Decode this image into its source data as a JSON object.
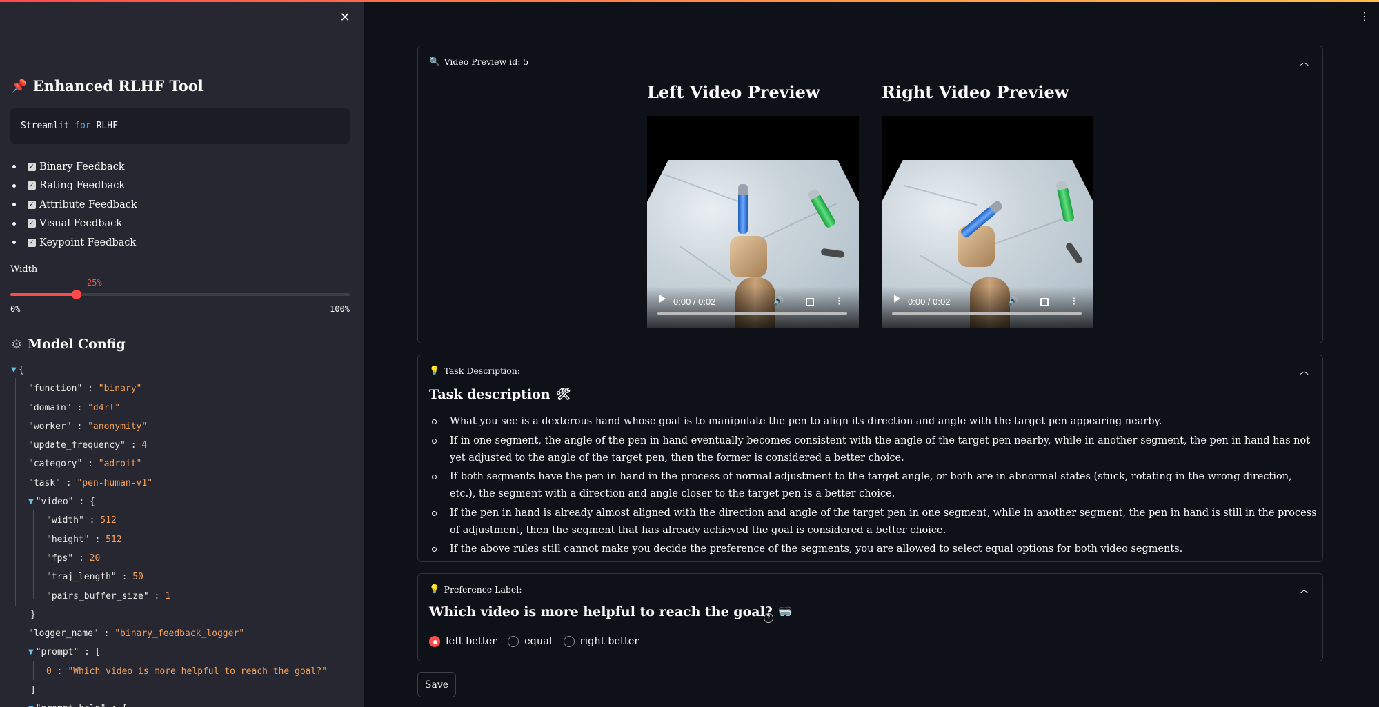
{
  "sidebar": {
    "close_icon": "close-icon",
    "title": "Enhanced RLHF Tool",
    "title_icon": "pushpin-icon",
    "code": {
      "word1": "Streamlit",
      "keyword": "for",
      "word2": "RLHF"
    },
    "features": [
      {
        "label": "Binary Feedback",
        "checked": true
      },
      {
        "label": "Rating Feedback",
        "checked": true
      },
      {
        "label": "Attribute Feedback",
        "checked": true
      },
      {
        "label": "Visual Feedback",
        "checked": true
      },
      {
        "label": "Keypoint Feedback",
        "checked": true
      }
    ],
    "width_slider": {
      "label": "Width",
      "value": 0.25,
      "value_text": "25%",
      "min": "0%",
      "max": "100%"
    },
    "model_config_title": "Model Config",
    "model_config_icon": "gear-icon",
    "json": {
      "function": "\"binary\"",
      "domain": "\"d4rl\"",
      "worker": "\"anonymity\"",
      "update_frequency": "4",
      "category": "\"adroit\"",
      "task": "\"pen-human-v1\"",
      "video_width": "512",
      "video_height": "512",
      "video_fps": "20",
      "video_traj_length": "50",
      "video_pairs_buffer_size": "1",
      "logger_name": "\"binary_feedback_logger\"",
      "prompt_0": "\"Which video is more helpful to reach the goal?\"",
      "keys": {
        "function": "\"function\"",
        "domain": "\"domain\"",
        "worker": "\"worker\"",
        "update_frequency": "\"update_frequency\"",
        "category": "\"category\"",
        "task": "\"task\"",
        "video": "\"video\"",
        "width": "\"width\"",
        "height": "\"height\"",
        "fps": "\"fps\"",
        "traj_length": "\"traj_length\"",
        "pairs_buffer_size": "\"pairs_buffer_size\"",
        "logger_name": "\"logger_name\"",
        "prompt": "\"prompt\"",
        "prompt_help": "\"prompt_help\""
      }
    }
  },
  "main": {
    "video_panel": {
      "header": "Video Preview id: 5",
      "header_icon": "magnifier-icon",
      "left_title": "Left Video Preview",
      "right_title": "Right Video Preview",
      "left_time": "0:00 / 0:02",
      "right_time": "0:00 / 0:02"
    },
    "task_panel": {
      "header": "Task Description:",
      "header_icon": "lightbulb-icon",
      "title": "Task description",
      "title_icon": "tools-icon",
      "items": [
        "What you see is a dexterous hand whose goal is to manipulate the pen to align its direction and angle with the target pen appearing nearby.",
        "If in one segment, the angle of the pen in hand eventually becomes consistent with the angle of the target pen nearby, while in another segment, the pen in hand has not yet adjusted to the angle of the target pen, then the former is considered a better choice.",
        "If both segments have the pen in hand in the process of normal adjustment to the target angle, or both are in abnormal states (stuck, rotating in the wrong direction, etc.), the segment with a direction and angle closer to the target pen is a better choice.",
        "If the pen in hand is already almost aligned with the direction and angle of the target pen in one segment, while in another segment, the pen in hand is still in the process of adjustment, then the segment that has already achieved the goal is considered a better choice.",
        "If the above rules still cannot make you decide the preference of the segments, you are allowed to select equal options for both video segments."
      ]
    },
    "pref_panel": {
      "header": "Preference Label:",
      "header_icon": "lightbulb-icon",
      "question": "Which video is more helpful to reach the goal?",
      "question_icon": "vr-goggles-icon",
      "help_icon": "question-circle-icon",
      "options": [
        "left better",
        "equal",
        "right better"
      ],
      "selected": "left better"
    },
    "save_label": "Save",
    "menu_icon": "kebab-menu-icon"
  },
  "colors": {
    "accent": "#ff4b4b",
    "sidebar_bg": "#262730",
    "main_bg": "#0e1117",
    "json_value": "#f5a05a"
  }
}
